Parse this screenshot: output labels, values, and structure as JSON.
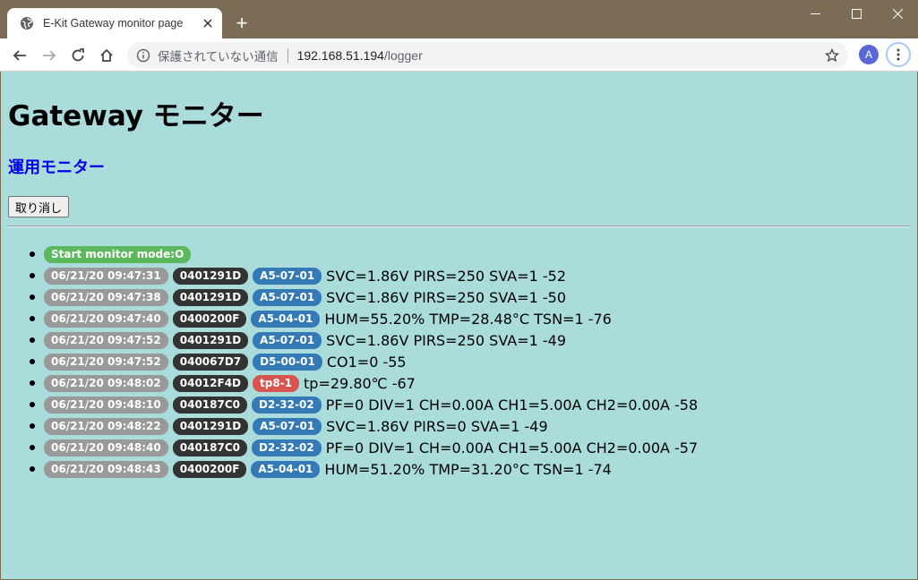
{
  "browser": {
    "tab_title": "E-Kit Gateway monitor page",
    "new_tab_symbol": "+",
    "address": {
      "security_label": "保護されていない通信",
      "host": "192.168.51.194",
      "path": "/logger"
    },
    "profile_initial": "A",
    "accent_color": "#5a67d8"
  },
  "page": {
    "title": "Gateway モニター",
    "subtitle": "運用モニター",
    "cancel_button": "取り消し",
    "background_color": "#aadcdc",
    "subtitle_color": "#0000ee",
    "start_badge": "Start monitor mode:O",
    "log": [
      {
        "time": "06/21/20 09:47:31",
        "id": "0401291D",
        "eep": "A5-07-01",
        "eep_style": "blue",
        "message": "SVC=1.86V PIRS=250 SVA=1 -52"
      },
      {
        "time": "06/21/20 09:47:38",
        "id": "0401291D",
        "eep": "A5-07-01",
        "eep_style": "blue",
        "message": "SVC=1.86V PIRS=250 SVA=1 -50"
      },
      {
        "time": "06/21/20 09:47:40",
        "id": "0400200F",
        "eep": "A5-04-01",
        "eep_style": "blue",
        "message": "HUM=55.20% TMP=28.48°C TSN=1 -76"
      },
      {
        "time": "06/21/20 09:47:52",
        "id": "0401291D",
        "eep": "A5-07-01",
        "eep_style": "blue",
        "message": "SVC=1.86V PIRS=250 SVA=1 -49"
      },
      {
        "time": "06/21/20 09:47:52",
        "id": "040067D7",
        "eep": "D5-00-01",
        "eep_style": "blue",
        "message": "CO1=0 -55"
      },
      {
        "time": "06/21/20 09:48:02",
        "id": "04012F4D",
        "eep": "tp8-1",
        "eep_style": "red",
        "message": "tp=29.80℃ -67"
      },
      {
        "time": "06/21/20 09:48:10",
        "id": "040187C0",
        "eep": "D2-32-02",
        "eep_style": "blue",
        "message": "PF=0 DIV=1 CH=0.00A CH1=5.00A CH2=0.00A -58"
      },
      {
        "time": "06/21/20 09:48:22",
        "id": "0401291D",
        "eep": "A5-07-01",
        "eep_style": "blue",
        "message": "SVC=1.86V PIRS=0 SVA=1 -49"
      },
      {
        "time": "06/21/20 09:48:40",
        "id": "040187C0",
        "eep": "D2-32-02",
        "eep_style": "blue",
        "message": "PF=0 DIV=1 CH=0.00A CH1=5.00A CH2=0.00A -57"
      },
      {
        "time": "06/21/20 09:48:43",
        "id": "0400200F",
        "eep": "A5-04-01",
        "eep_style": "blue",
        "message": "HUM=51.20% TMP=31.20°C TSN=1 -74"
      }
    ]
  }
}
